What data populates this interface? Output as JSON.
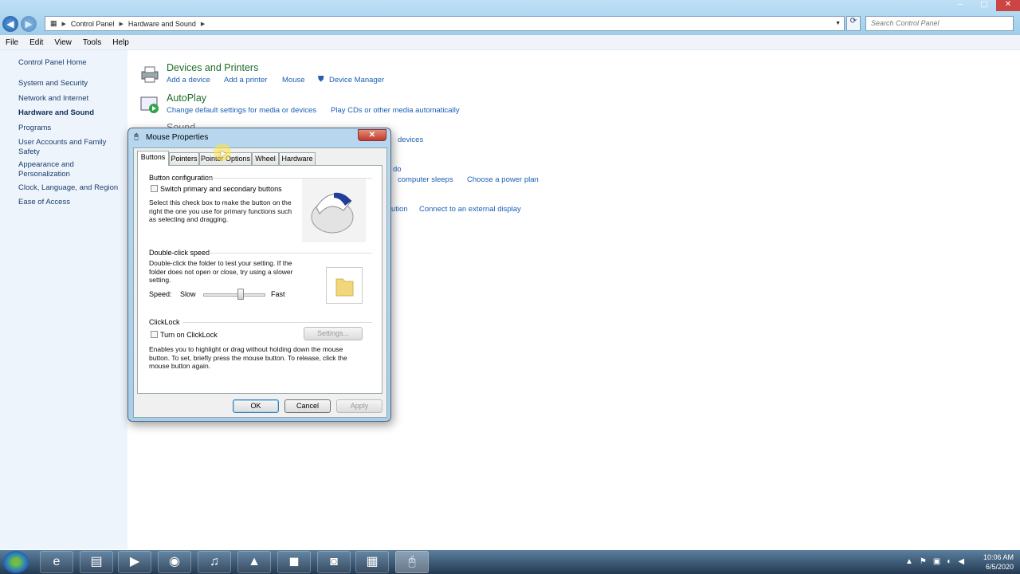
{
  "window": {
    "caption_buttons": [
      "minimize-icon",
      "maximize-icon",
      "close-icon"
    ]
  },
  "address": {
    "segments": [
      "Control Panel",
      "Hardware and Sound"
    ],
    "search_placeholder": "Search Control Panel"
  },
  "menu": [
    "File",
    "Edit",
    "View",
    "Tools",
    "Help"
  ],
  "sidebar": {
    "items": [
      {
        "label": "Control Panel Home"
      },
      {
        "label": "System and Security"
      },
      {
        "label": "Network and Internet"
      },
      {
        "label": "Hardware and Sound"
      },
      {
        "label": "Programs"
      },
      {
        "label": "User Accounts and Family Safety"
      },
      {
        "label": "Appearance and Personalization"
      },
      {
        "label": "Clock, Language, and Region"
      },
      {
        "label": "Ease of Access"
      }
    ]
  },
  "categories": {
    "devices": {
      "title": "Devices and Printers",
      "links": [
        "Add a device",
        "Add a printer",
        "Mouse",
        "Device Manager"
      ]
    },
    "autoplay": {
      "title": "AutoPlay",
      "links": [
        "Change default settings for media or devices",
        "Play CDs or other media automatically"
      ]
    },
    "sound": {
      "title": "Sound",
      "partial_links": [
        "devices"
      ]
    },
    "power": {
      "partial_links": [
        "do",
        "computer sleeps",
        "Choose a power plan"
      ]
    },
    "display": {
      "partial_links": [
        "ution",
        "Connect to an external display"
      ]
    }
  },
  "dialog": {
    "title": "Mouse Properties",
    "tabs": [
      "Buttons",
      "Pointers",
      "Pointer Options",
      "Wheel",
      "Hardware"
    ],
    "active_tab": "Buttons",
    "button_config": {
      "heading": "Button configuration",
      "checkbox_label": "Switch primary and secondary buttons",
      "checked": false,
      "description": "Select this check box to make the button on the right the one you use for primary functions such as selecting and dragging."
    },
    "double_click": {
      "heading": "Double-click speed",
      "description": "Double-click the folder to test your setting. If the folder does not open or close, try using a slower setting.",
      "speed_label": "Speed:",
      "slow": "Slow",
      "fast": "Fast",
      "speed_value": 0.6
    },
    "clicklock": {
      "heading": "ClickLock",
      "checkbox_label": "Turn on ClickLock",
      "checked": false,
      "settings_button": "Settings...",
      "description": "Enables you to highlight or drag without holding down the mouse button. To set, briefly press the mouse button. To release, click the mouse button again."
    },
    "buttons": {
      "ok": "OK",
      "cancel": "Cancel",
      "apply": "Apply"
    }
  },
  "taskbar": {
    "apps": [
      "internet-explorer-icon",
      "file-explorer-icon",
      "media-player-icon",
      "chrome-icon",
      "headphones-app-icon",
      "green-triangle-app-icon",
      "orange-app-icon",
      "camera-app-icon",
      "control-panel-icon",
      "mouse-app-icon"
    ],
    "time": "10:06 AM",
    "date": "6/5/2020"
  },
  "colors": {
    "link": "#1a5fb4",
    "category_title": "#1e6c2a",
    "sidebar_bg": "#eef4fb"
  }
}
